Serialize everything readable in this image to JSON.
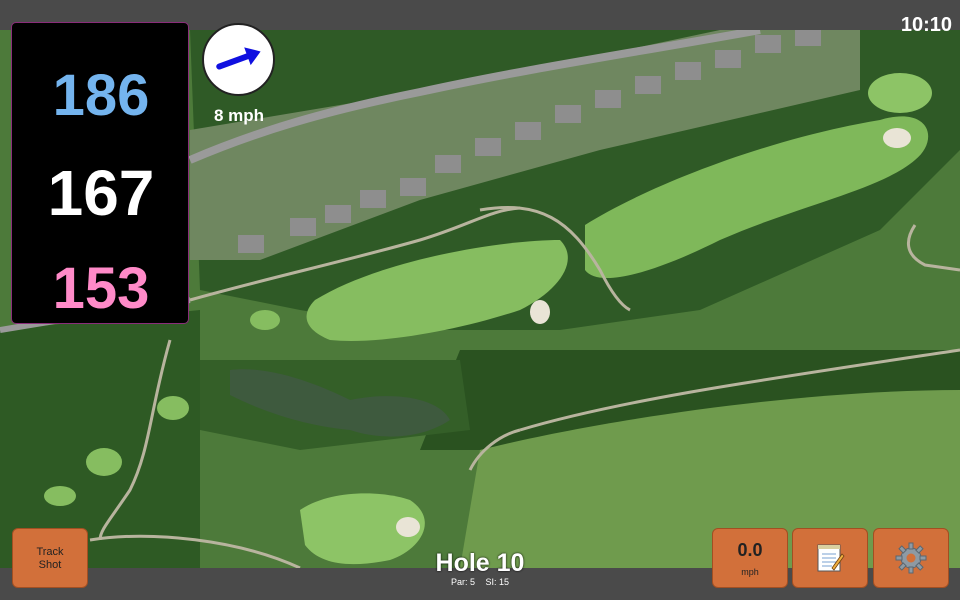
{
  "status": {
    "time": "10:10"
  },
  "distances": {
    "back": "186",
    "middle": "167",
    "front": "153"
  },
  "wind": {
    "speed_label": "8 mph",
    "direction_icon": "arrow-icon"
  },
  "buttons": {
    "track_shot": "Track\nShot",
    "wind_value": "0.0",
    "wind_unit": "mph",
    "notes_icon": "notepad-icon",
    "settings_icon": "gear-icon"
  },
  "hole": {
    "title": "Hole 10",
    "par": "Par: 5",
    "si": "SI: 15"
  },
  "colors": {
    "accent": "#d2703a",
    "back_dist": "#74b4ee",
    "front_dist": "#ff8ac8"
  }
}
